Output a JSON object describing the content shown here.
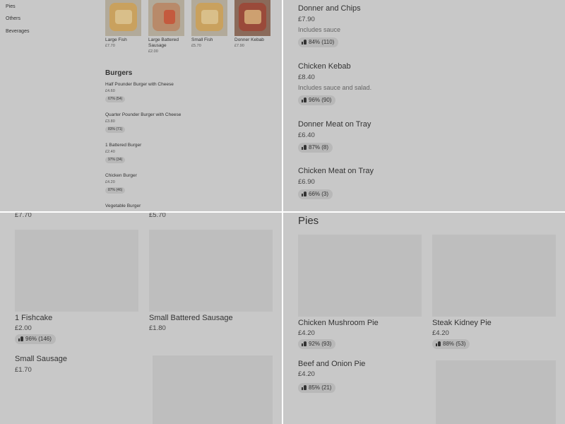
{
  "categories": [
    "Pies",
    "Others",
    "Beverages"
  ],
  "popular": [
    {
      "name": "Large Fish",
      "price": "£7.70"
    },
    {
      "name": "Large Battered Sausage",
      "price": "£2.00"
    },
    {
      "name": "Small Fish",
      "price": "£5.70"
    },
    {
      "name": "Donner Kebab",
      "price": "£7.90"
    }
  ],
  "burgers": {
    "heading": "Burgers",
    "items": [
      {
        "name": "Half Pounder Burger with Cheese",
        "price": "£4.60",
        "rating": "67% (54)"
      },
      {
        "name": "Quarter Pounder Burger with Cheese",
        "price": "£3.80",
        "rating": "83% (71)"
      },
      {
        "name": "1 Battered Burger",
        "price": "£2.40",
        "rating": "97% (34)"
      },
      {
        "name": "Chicken Burger",
        "price": "£4.20",
        "rating": "87% (46)"
      },
      {
        "name": "Vegetable Burger",
        "price": "",
        "rating": ""
      }
    ]
  },
  "kebabs": [
    {
      "name": "Donner and Chips",
      "price": "£7.90",
      "desc": "Includes sauce",
      "rating": "84% (110)"
    },
    {
      "name": "Chicken Kebab",
      "price": "£8.40",
      "desc": "Includes sauce and salad.",
      "rating": "96% (90)"
    },
    {
      "name": "Donner Meat on Tray",
      "price": "£6.40",
      "desc": "",
      "rating": "87% (8)"
    },
    {
      "name": "Chicken Meat on Tray",
      "price": "£6.90",
      "desc": "",
      "rating": "66% (3)"
    }
  ],
  "fish_section": {
    "top_prices": [
      "£7.70",
      "£5.70"
    ],
    "items": [
      {
        "name": "1 Fishcake",
        "price": "£2.00",
        "rating": "96% (146)"
      },
      {
        "name": "Small Battered Sausage",
        "price": "£1.80",
        "rating": ""
      },
      {
        "name": "Small Sausage",
        "price": "£1.70",
        "rating": ""
      }
    ]
  },
  "pies": {
    "heading": "Pies",
    "items": [
      {
        "name": "Chicken Mushroom Pie",
        "price": "£4.20",
        "rating": "92% (93)"
      },
      {
        "name": "Steak Kidney Pie",
        "price": "£4.20",
        "rating": "88% (53)"
      },
      {
        "name": "Beef and Onion Pie",
        "price": "£4.20",
        "rating": "85% (21)"
      }
    ]
  },
  "icons": {
    "rating": "thumbs-up-icon"
  }
}
